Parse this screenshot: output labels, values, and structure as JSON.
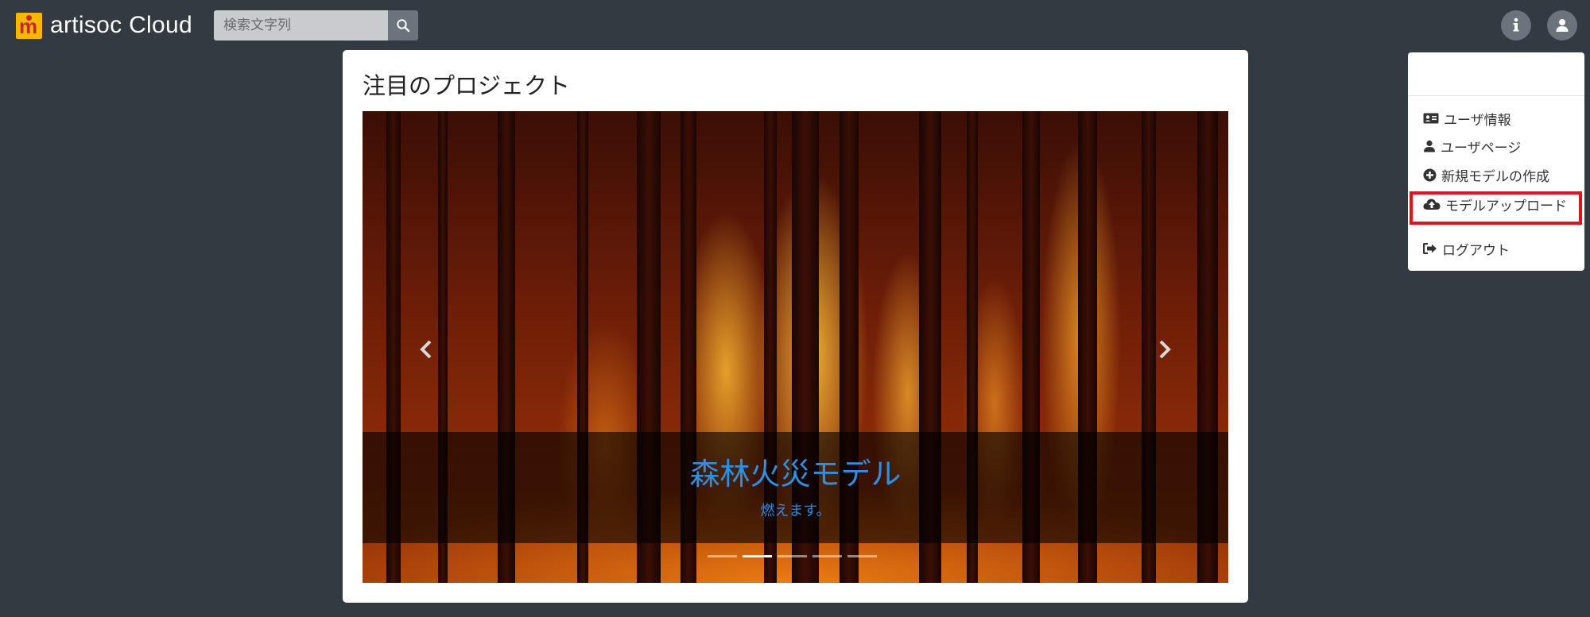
{
  "navbar": {
    "brand": "artisoc Cloud",
    "logo_letter": "m",
    "search_placeholder": "検索文字列",
    "icons": {
      "search": "search-icon",
      "info": "info-icon",
      "user": "user-icon"
    }
  },
  "featured": {
    "heading": "注目のプロジェクト",
    "slide": {
      "title": "森林火災モデル",
      "subtitle": "燃えます。"
    },
    "indicator_count": 5,
    "active_indicator": 2
  },
  "dropdown": {
    "items": [
      {
        "label": "ユーザ情報",
        "icon": "id-card-icon"
      },
      {
        "label": "ユーザページ",
        "icon": "user-icon"
      },
      {
        "label": "新規モデルの作成",
        "icon": "plus-circle-icon"
      },
      {
        "label": "モデルアップロード",
        "icon": "cloud-upload-icon",
        "highlighted": true
      },
      {
        "label": "ログアウト",
        "icon": "sign-out-icon"
      }
    ]
  },
  "colors": {
    "background": "#343a42",
    "caption_text": "#2f8fe0",
    "highlight_border": "#e5101a",
    "logo_bg": "#f5b800",
    "logo_fg": "#c62828"
  }
}
